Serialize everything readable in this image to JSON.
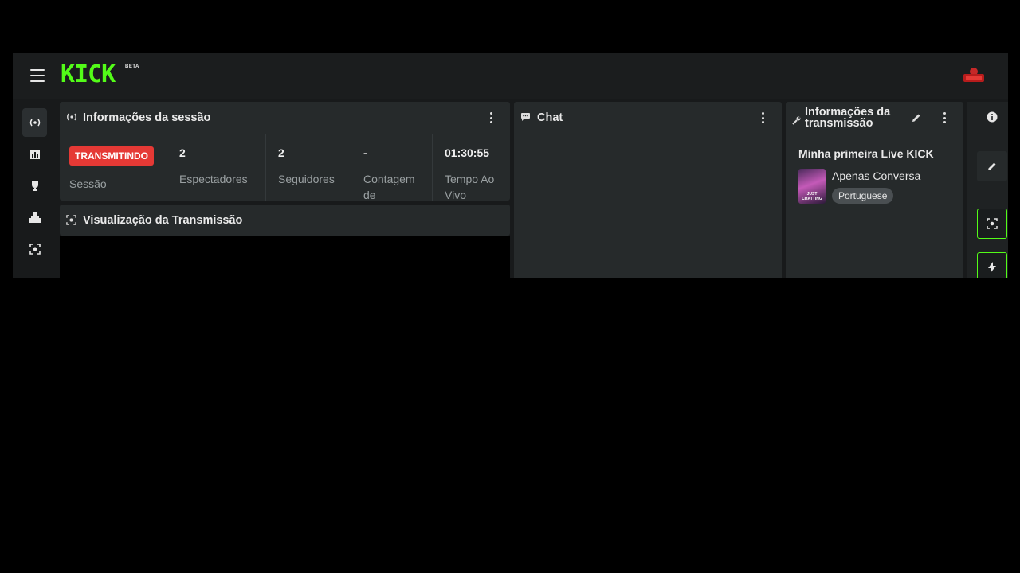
{
  "app": {
    "logo_text": "KICK",
    "beta_label": "BETA",
    "brand_color": "#53fc18"
  },
  "left_rail": [
    {
      "icon": "broadcast-icon",
      "active": true
    },
    {
      "icon": "chart-icon",
      "active": false
    },
    {
      "icon": "trophy-icon",
      "active": false
    },
    {
      "icon": "queue-icon",
      "active": false
    },
    {
      "icon": "screen-capture-icon",
      "active": false
    }
  ],
  "session_panel": {
    "title": "Informações da sessão",
    "status_badge": "TRANSMITINDO",
    "status_color": "#e53935",
    "session_label": "Sessão",
    "stats": [
      {
        "value": "2",
        "label": "Espectadores"
      },
      {
        "value": "2",
        "label": "Seguidores"
      },
      {
        "value": "-",
        "label": "Contagem de"
      },
      {
        "value": "01:30:55",
        "label": "Tempo Ao Vivo"
      }
    ]
  },
  "preview_panel": {
    "title": "Visualização da Transmissão"
  },
  "chat_panel": {
    "title": "Chat"
  },
  "stream_info_panel": {
    "title_line1": "Informações da",
    "title_line2": "transmissão",
    "stream_title": "Minha primeira Live KICK",
    "category": "Apenas Conversa",
    "thumb_text": "JUST CHATTING",
    "language_tag": "Portuguese"
  },
  "right_rail": [
    {
      "icon": "info-icon"
    },
    {
      "icon": "pencil-icon"
    },
    {
      "icon": "screen-capture-icon"
    },
    {
      "icon": "lightning-icon"
    }
  ]
}
